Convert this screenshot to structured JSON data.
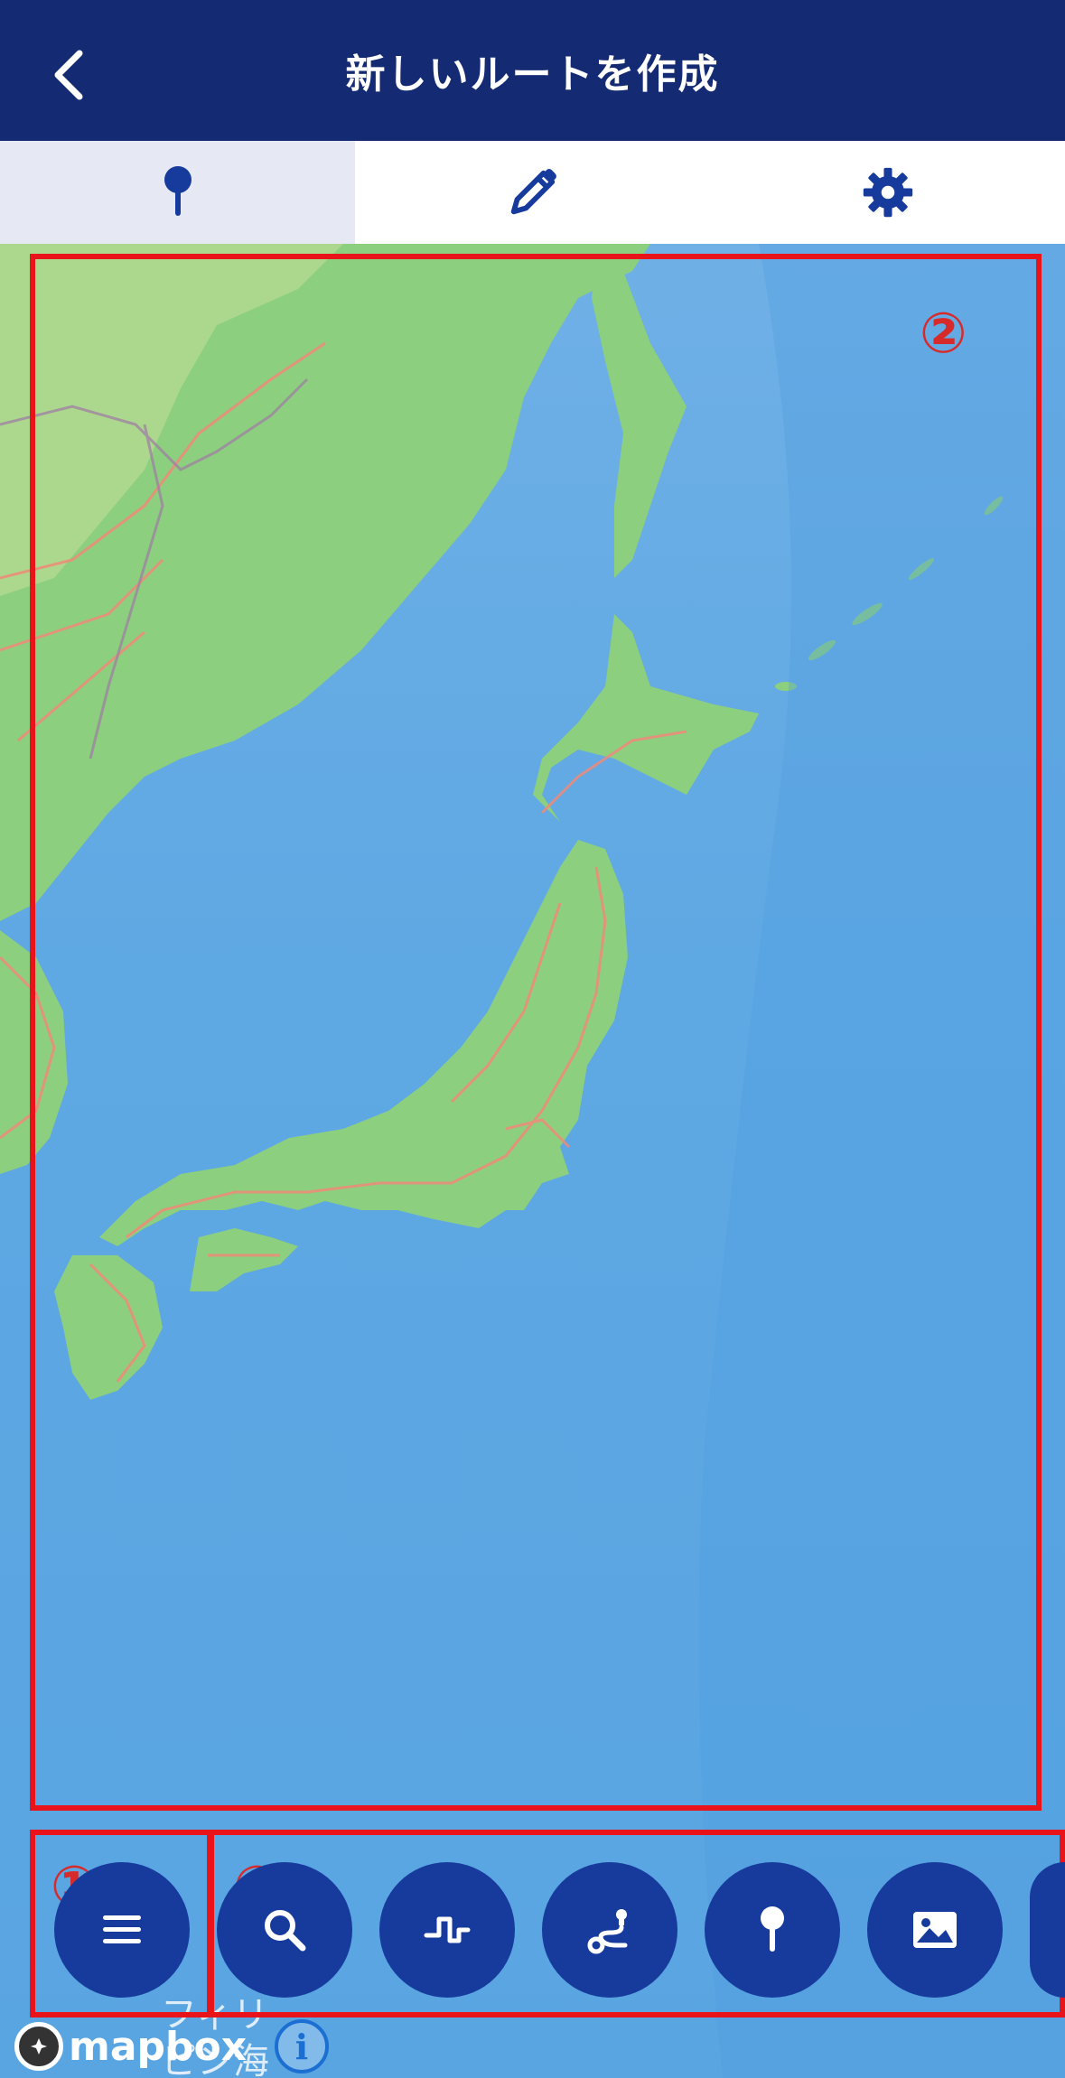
{
  "header": {
    "title": "新しいルートを作成"
  },
  "tabs": [
    "pin",
    "pencil",
    "settings"
  ],
  "annotations": [
    "①",
    "②",
    "③"
  ],
  "map_labels": {
    "sea_line1": "フィリ",
    "sea_line2": "ピン海"
  },
  "attribution": {
    "brand": "mapbox",
    "info": "i"
  },
  "colors": {
    "header": "#142a73",
    "accent": "#163b9c",
    "annotation": "#e8141a",
    "ocean": "#5ea8e3",
    "land": "#8ccf7e"
  }
}
